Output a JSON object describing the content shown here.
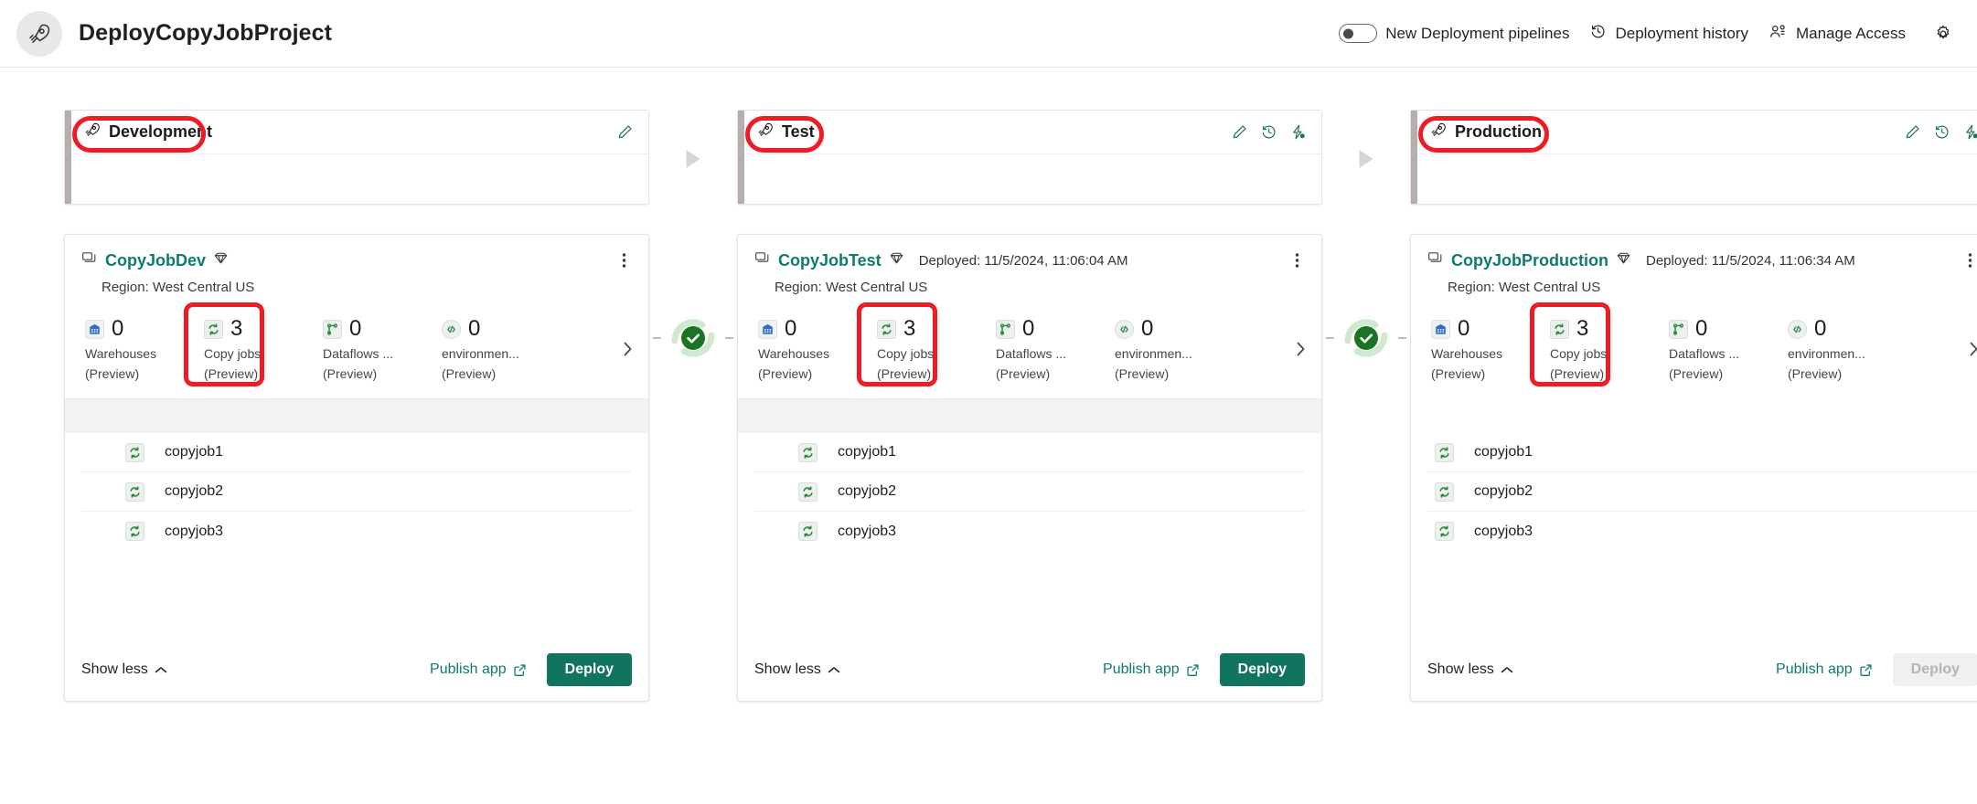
{
  "header": {
    "app_icon": "rocket-icon",
    "title": "DeployCopyJobProject",
    "toggle": {
      "label": "New Deployment pipelines",
      "state": "off"
    },
    "deployment_history": {
      "label": "Deployment history",
      "icon": "history-icon"
    },
    "manage_access": {
      "label": "Manage Access",
      "icon": "people-icon"
    },
    "settings": {
      "icon": "gear-icon"
    }
  },
  "stages": [
    {
      "name": "Development",
      "icon": "rocket-icon",
      "annotated": true,
      "actions": [
        "edit-icon"
      ]
    },
    {
      "name": "Test",
      "icon": "rocket-icon",
      "annotated": true,
      "actions": [
        "edit-icon",
        "history-icon",
        "deployment-rules-icon"
      ]
    },
    {
      "name": "Production",
      "icon": "rocket-icon",
      "annotated": true,
      "actions": [
        "edit-icon",
        "history-icon",
        "deployment-rules-icon"
      ]
    }
  ],
  "workspaces": [
    {
      "name": "CopyJobDev",
      "license_icon": "fabric-capacity-diamond-icon",
      "deployed": "",
      "region": "Region: West Central US",
      "item_types": [
        {
          "icon": "warehouse-icon",
          "count": "0",
          "label": "Warehouses",
          "preview": "(Preview)",
          "highlighted": false
        },
        {
          "icon": "copy-job-icon",
          "count": "3",
          "label": "Copy jobs",
          "preview": "(Preview)",
          "highlighted": true
        },
        {
          "icon": "dataflow-icon",
          "count": "0",
          "label": "Dataflows ...",
          "preview": "(Preview)",
          "highlighted": false
        },
        {
          "icon": "environment-icon",
          "count": "0",
          "label": "environmen...",
          "preview": "(Preview)",
          "highlighted": false
        }
      ],
      "items": [
        {
          "icon": "copy-job-icon",
          "name": "copyjob1"
        },
        {
          "icon": "copy-job-icon",
          "name": "copyjob2"
        },
        {
          "icon": "copy-job-icon",
          "name": "copyjob3"
        }
      ],
      "show_less_label": "Show less",
      "publish_app_label": "Publish app",
      "deploy_label": "Deploy",
      "deploy_disabled": false
    },
    {
      "name": "CopyJobTest",
      "license_icon": "fabric-capacity-diamond-icon",
      "deployed": "Deployed: 11/5/2024, 11:06:04 AM",
      "region": "Region: West Central US",
      "item_types": [
        {
          "icon": "warehouse-icon",
          "count": "0",
          "label": "Warehouses",
          "preview": "(Preview)",
          "highlighted": false
        },
        {
          "icon": "copy-job-icon",
          "count": "3",
          "label": "Copy jobs",
          "preview": "(Preview)",
          "highlighted": true
        },
        {
          "icon": "dataflow-icon",
          "count": "0",
          "label": "Dataflows ...",
          "preview": "(Preview)",
          "highlighted": false
        },
        {
          "icon": "environment-icon",
          "count": "0",
          "label": "environmen...",
          "preview": "(Preview)",
          "highlighted": false
        }
      ],
      "items": [
        {
          "icon": "copy-job-icon",
          "name": "copyjob1"
        },
        {
          "icon": "copy-job-icon",
          "name": "copyjob2"
        },
        {
          "icon": "copy-job-icon",
          "name": "copyjob3"
        }
      ],
      "show_less_label": "Show less",
      "publish_app_label": "Publish app",
      "deploy_label": "Deploy",
      "deploy_disabled": false
    },
    {
      "name": "CopyJobProduction",
      "license_icon": "fabric-capacity-diamond-icon",
      "deployed": "Deployed: 11/5/2024, 11:06:34 AM",
      "region": "Region: West Central US",
      "item_types": [
        {
          "icon": "warehouse-icon",
          "count": "0",
          "label": "Warehouses",
          "preview": "(Preview)",
          "highlighted": false
        },
        {
          "icon": "copy-job-icon",
          "count": "3",
          "label": "Copy jobs",
          "preview": "(Preview)",
          "highlighted": true
        },
        {
          "icon": "dataflow-icon",
          "count": "0",
          "label": "Dataflows ...",
          "preview": "(Preview)",
          "highlighted": false
        },
        {
          "icon": "environment-icon",
          "count": "0",
          "label": "environmen...",
          "preview": "(Preview)",
          "highlighted": false
        }
      ],
      "items": [
        {
          "icon": "copy-job-icon",
          "name": "copyjob1"
        },
        {
          "icon": "copy-job-icon",
          "name": "copyjob2"
        },
        {
          "icon": "copy-job-icon",
          "name": "copyjob3"
        }
      ],
      "show_less_label": "Show less",
      "publish_app_label": "Publish app",
      "deploy_label": "Deploy",
      "deploy_disabled": true
    }
  ],
  "compare_badges": [
    {
      "state": "in-sync",
      "icon": "sync-check-icon"
    },
    {
      "state": "in-sync",
      "icon": "sync-check-icon"
    }
  ],
  "colors": {
    "accent_teal": "#107a6e",
    "deploy_green": "#11745f",
    "annotation_red": "#ee1c25",
    "sync_green": "#1d7324",
    "sync_green_light": "#cfe8cf",
    "stage_rail_gray": "#b5b0ad",
    "band_gray": "#f3f2f1"
  }
}
